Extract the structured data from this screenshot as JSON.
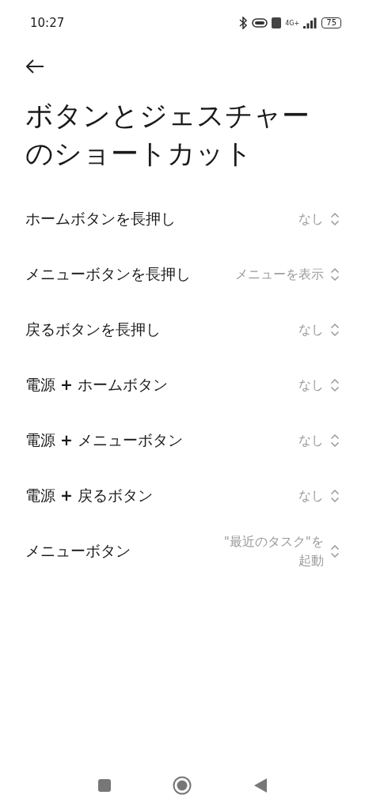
{
  "status_bar": {
    "time": "10:27",
    "network": "4G+",
    "battery": "75"
  },
  "title": "ボタンとジェスチャーのショートカット",
  "rows": [
    {
      "label": "ホームボタンを長押し",
      "value": "なし"
    },
    {
      "label": "メニューボタンを長押し",
      "value": "メニューを表示"
    },
    {
      "label": "戻るボタンを長押し",
      "value": "なし"
    },
    {
      "label": "電源 **+** ホームボタン",
      "value": "なし"
    },
    {
      "label": "電源 **+** メニューボタン",
      "value": "なし"
    },
    {
      "label": "電源 **+** 戻るボタン",
      "value": "なし"
    },
    {
      "label": "メニューボタン",
      "value": "\"最近のタスク\"を起動"
    }
  ]
}
